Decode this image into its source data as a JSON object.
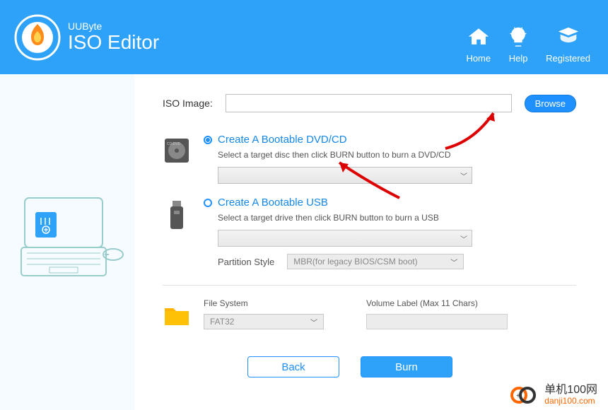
{
  "titlebar": {
    "min": "—",
    "close": "✕"
  },
  "brand": "UUByte",
  "title": "ISO Editor",
  "nav": {
    "home": "Home",
    "help": "Help",
    "registered": "Registered"
  },
  "iso_label": "ISO Image:",
  "browse_label": "Browse",
  "dvd": {
    "title": "Create A Bootable DVD/CD",
    "desc": "Select a target disc then click BURN button to burn a DVD/CD",
    "selected": ""
  },
  "usb": {
    "title": "Create A Bootable USB",
    "desc": "Select a target drive then click BURN button to burn a USB",
    "selected": "",
    "partition_label": "Partition Style",
    "partition_value": "MBR(for legacy BIOS/CSM boot)"
  },
  "fs": {
    "label": "File System",
    "value": "FAT32"
  },
  "volume": {
    "label": "Volume Label (Max 11 Chars)",
    "value": ""
  },
  "buttons": {
    "back": "Back",
    "burn": "Burn"
  },
  "watermark": {
    "cn": "单机100网",
    "domain": "danji100.com"
  }
}
